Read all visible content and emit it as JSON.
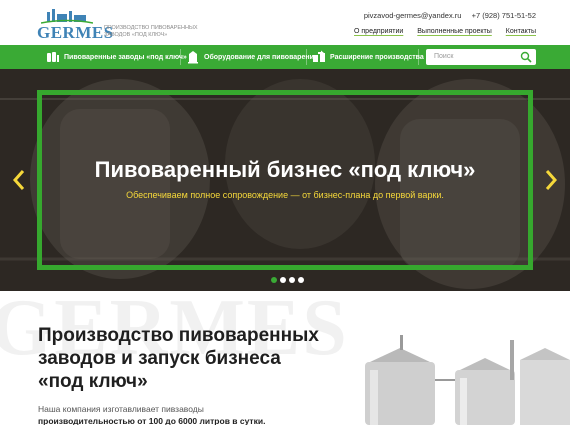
{
  "header": {
    "brand": "GERMES",
    "tagline": "Производство пивоваренных заводов «под ключ»",
    "email": "pivzavod-germes@yandex.ru",
    "phone": "+7 (928) 751-51-52",
    "nav": [
      "О предприятии",
      "Выполненные проекты",
      "Контакты"
    ]
  },
  "menu": {
    "items": [
      "Пивоваренные заводы «под ключ»",
      "Оборудование для пивоварения",
      "Расширение производства"
    ],
    "search_placeholder": "Поиск"
  },
  "hero": {
    "title": "Пивоваренный бизнес «под ключ»",
    "subtitle": "Обеспечиваем полное сопровождение — от бизнес-плана до первой варки.",
    "slides": 4,
    "active_slide": 1
  },
  "intro": {
    "watermark": "GERMES",
    "headline_lines": [
      "Производство пивоваренных",
      "заводов и запуск бизнеса",
      "«под ключ»"
    ],
    "para_lines": [
      "Наша компания изготавливает пивзаводы",
      "производительностью от 100 до 6000 литров в сутки."
    ]
  },
  "colors": {
    "accent": "#3aaa35",
    "subtitle": "#f5d83a",
    "logo": "#3f83b6"
  }
}
